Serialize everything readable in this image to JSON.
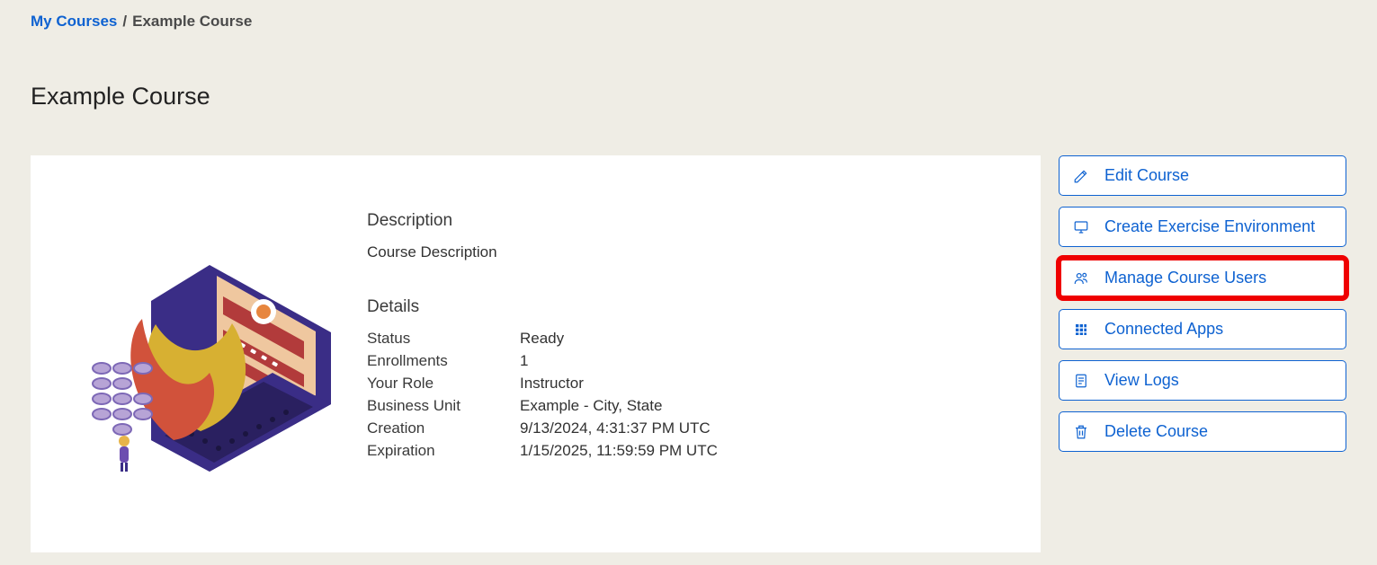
{
  "breadcrumb": {
    "link_text": "My Courses",
    "current": "Example Course"
  },
  "page_title": "Example Course",
  "description": {
    "heading": "Description",
    "text": "Course Description"
  },
  "details": {
    "heading": "Details",
    "rows": [
      {
        "label": "Status",
        "value": "Ready"
      },
      {
        "label": "Enrollments",
        "value": "1"
      },
      {
        "label": "Your Role",
        "value": "Instructor"
      },
      {
        "label": "Business Unit",
        "value": "Example - City, State"
      },
      {
        "label": "Creation",
        "value": "9/13/2024, 4:31:37 PM UTC"
      },
      {
        "label": "Expiration",
        "value": "1/15/2025, 11:59:59 PM UTC"
      }
    ]
  },
  "actions": {
    "edit": "Edit Course",
    "create_env": "Create Exercise Environment",
    "manage_users": "Manage Course Users",
    "connected_apps": "Connected Apps",
    "view_logs": "View Logs",
    "delete": "Delete Course"
  }
}
